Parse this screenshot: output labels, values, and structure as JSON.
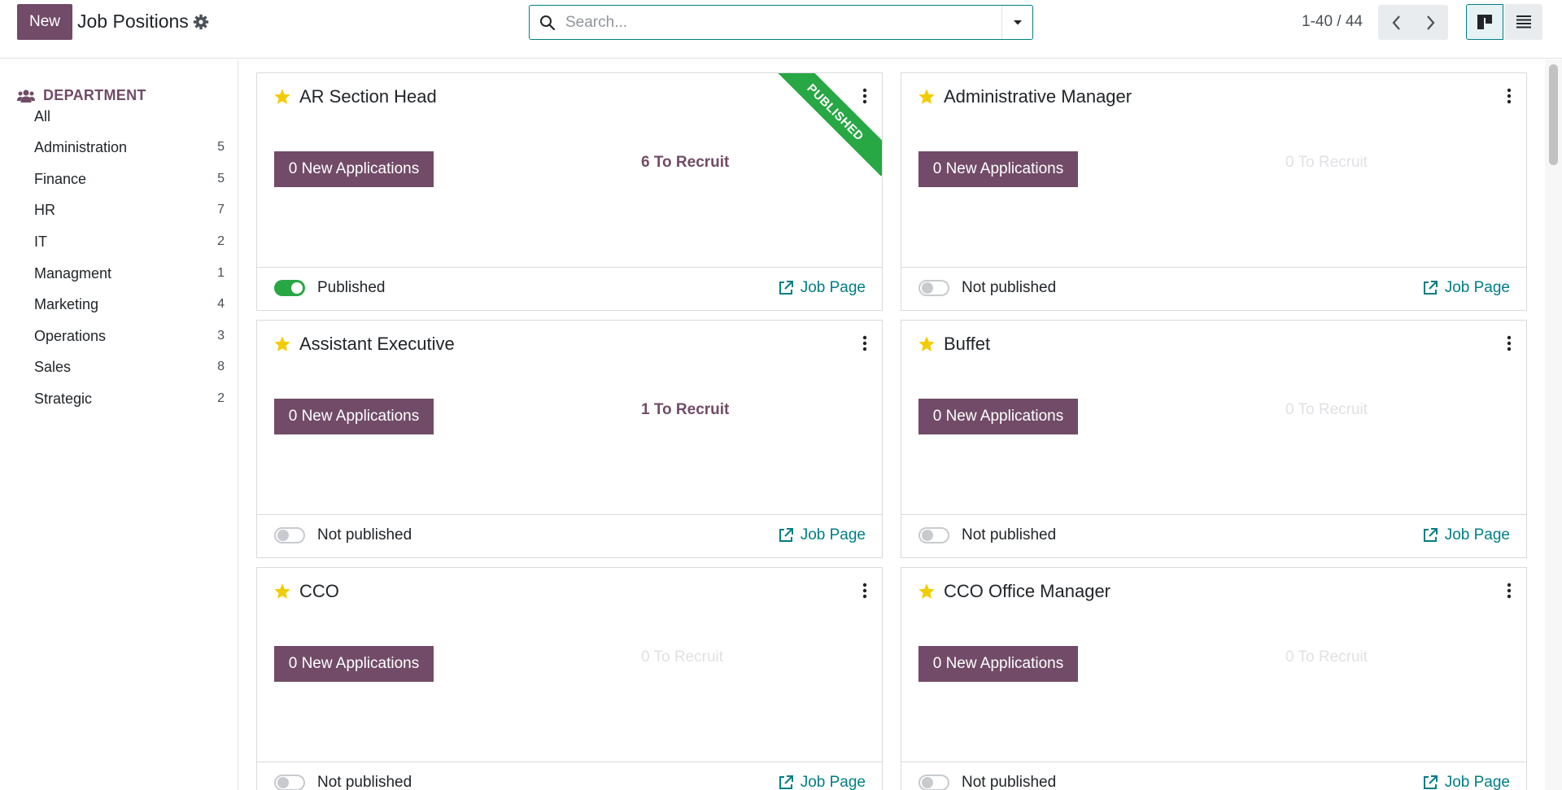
{
  "control_panel": {
    "new_label": "New",
    "title": "Job Positions",
    "search_placeholder": "Search...",
    "pager_value": "1-40 / 44"
  },
  "sidebar": {
    "header": "DEPARTMENT",
    "items": [
      {
        "label": "All",
        "count": ""
      },
      {
        "label": "Administration",
        "count": "5"
      },
      {
        "label": "Finance",
        "count": "5"
      },
      {
        "label": "HR",
        "count": "7"
      },
      {
        "label": "IT",
        "count": "2"
      },
      {
        "label": "Managment",
        "count": "1"
      },
      {
        "label": "Marketing",
        "count": "4"
      },
      {
        "label": "Operations",
        "count": "3"
      },
      {
        "label": "Sales",
        "count": "8"
      },
      {
        "label": "Strategic",
        "count": "2"
      }
    ]
  },
  "cards": [
    {
      "title": "AR Section Head",
      "apps": "0 New Applications",
      "recruit": "6 To Recruit",
      "recruit_active": true,
      "status": "Published",
      "published": true,
      "ribbon": "PUBLISHED",
      "link": "Job Page"
    },
    {
      "title": "Administrative Manager",
      "apps": "0 New Applications",
      "recruit": "0 To Recruit",
      "recruit_active": false,
      "status": "Not published",
      "published": false,
      "link": "Job Page"
    },
    {
      "title": "Assistant Executive",
      "apps": "0 New Applications",
      "recruit": "1 To Recruit",
      "recruit_active": true,
      "status": "Not published",
      "published": false,
      "link": "Job Page"
    },
    {
      "title": "Buffet",
      "apps": "0 New Applications",
      "recruit": "0 To Recruit",
      "recruit_active": false,
      "status": "Not published",
      "published": false,
      "link": "Job Page"
    },
    {
      "title": "CCO",
      "apps": "0 New Applications",
      "recruit": "0 To Recruit",
      "recruit_active": false,
      "status": "Not published",
      "published": false,
      "link": "Job Page"
    },
    {
      "title": "CCO Office Manager",
      "apps": "0 New Applications",
      "recruit": "0 To Recruit",
      "recruit_active": false,
      "status": "Not published",
      "published": false,
      "link": "Job Page"
    }
  ],
  "colors": {
    "brand": "#714b67",
    "link": "#017e84",
    "success": "#28a745",
    "star": "#f3cc00"
  },
  "icons": {
    "gear": "gear-icon",
    "search": "search-icon",
    "caret": "caret-down-icon",
    "star": "star-icon",
    "menu": "kebab-menu-icon",
    "external": "external-link-icon",
    "department": "users-icon"
  }
}
